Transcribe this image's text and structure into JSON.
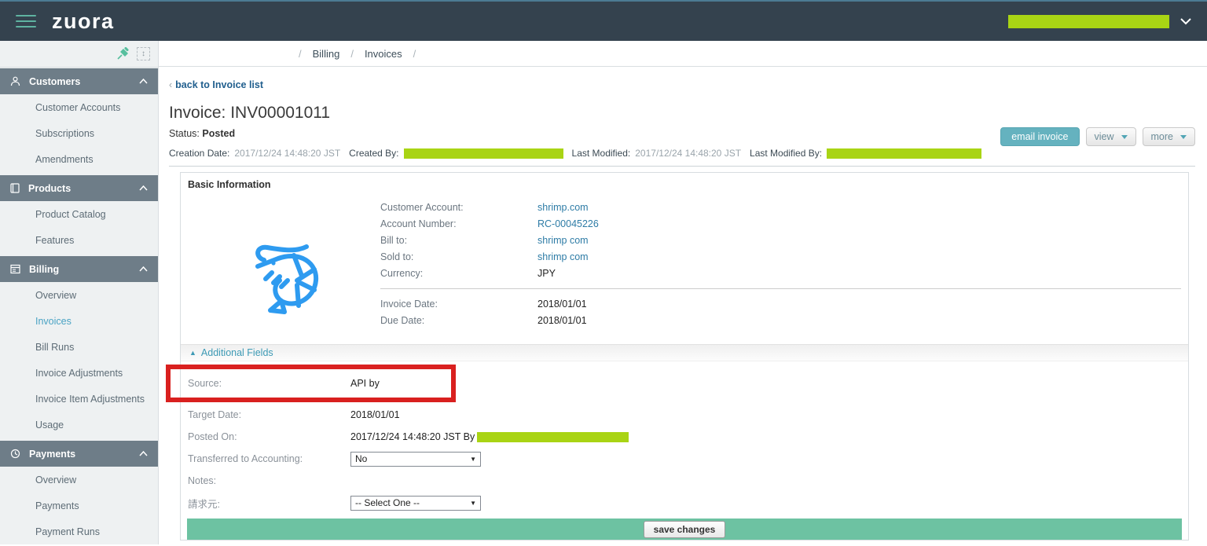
{
  "colors": {
    "topbar_bg": "#34424e",
    "accent_teal": "#5fb3a1",
    "redaction_green": "#a9d414",
    "section_header_bg": "#6e7d88",
    "active_item": "#4aa3c4",
    "link": "#2e7ca6",
    "email_button_bg": "#65b2bf",
    "save_bar_bg": "#6dc2a2",
    "annotation_red": "#d9201f"
  },
  "topbar": {
    "logo": "zuora"
  },
  "sidebar": {
    "icons": [
      "customers-icon",
      "products-icon",
      "billing-icon",
      "payments-icon"
    ],
    "sections": [
      {
        "label": "Customers",
        "items": [
          "Customer Accounts",
          "Subscriptions",
          "Amendments"
        ]
      },
      {
        "label": "Products",
        "items": [
          "Product Catalog",
          "Features"
        ]
      },
      {
        "label": "Billing",
        "items": [
          "Overview",
          "Invoices",
          "Bill Runs",
          "Invoice Adjustments",
          "Invoice Item Adjustments",
          "Usage"
        ],
        "active_item": "Invoices"
      },
      {
        "label": "Payments",
        "items": [
          "Overview",
          "Payments",
          "Payment Runs"
        ]
      }
    ]
  },
  "breadcrumb": {
    "sep": "/",
    "items": [
      "Billing",
      "Invoices"
    ]
  },
  "page": {
    "back_link": "back to Invoice list",
    "back_arrow": "‹",
    "title": "Invoice: INV00001011",
    "status_label": "Status:",
    "status_value": "Posted",
    "actions": {
      "email": "email invoice",
      "view": "view",
      "more": "more"
    },
    "meta": {
      "creation_date_label": "Creation Date:",
      "creation_date": "2017/12/24 14:48:20 JST",
      "created_by_label": "Created By:",
      "last_modified_label": "Last Modified:",
      "last_modified": "2017/12/24 14:48:20 JST",
      "last_modified_by_label": "Last Modified By:"
    }
  },
  "basic_info": {
    "title": "Basic Information",
    "logo_icon": "shrimp-logo",
    "fields": [
      {
        "label": "Customer Account:",
        "value": "shrimp.com"
      },
      {
        "label": "Account Number:",
        "value": "RC-00045226"
      },
      {
        "label": "Bill to:",
        "value": "shrimp com"
      },
      {
        "label": "Sold to:",
        "value": "shrimp com"
      },
      {
        "label": "Currency:",
        "value": "JPY"
      }
    ],
    "dates": [
      {
        "label": "Invoice Date:",
        "value": "2018/01/01"
      },
      {
        "label": "Due Date:",
        "value": "2018/01/01"
      }
    ]
  },
  "additional": {
    "title": "Additional Fields",
    "caret": "▲",
    "source_label": "Source:",
    "source_value": "API by",
    "target_label": "Target Date:",
    "target_value": "2018/01/01",
    "posted_label": "Posted On:",
    "posted_value": "2017/12/24 14:48:20 JST By",
    "transferred_label": "Transferred to Accounting:",
    "transferred_value": "No",
    "notes_label": "Notes:",
    "billing_source_label": "請求元:",
    "billing_source_value": "-- Select One --",
    "select_arrow": "▼",
    "save_button": "save changes"
  }
}
